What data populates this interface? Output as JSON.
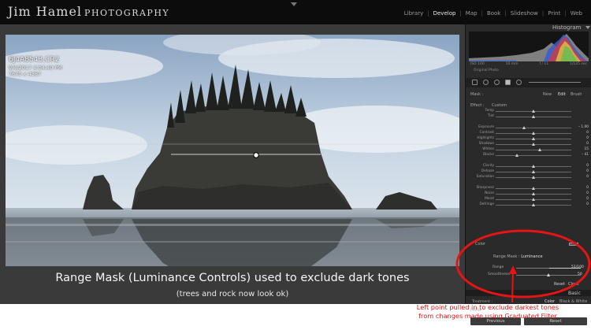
{
  "app": {
    "brand_main": "Jim Hamel",
    "brand_sub": "PHOTOGRAPHY"
  },
  "modules": [
    {
      "label": "Library",
      "active": false
    },
    {
      "label": "Develop",
      "active": true
    },
    {
      "label": "Map",
      "active": false
    },
    {
      "label": "Book",
      "active": false
    },
    {
      "label": "Slideshow",
      "active": false
    },
    {
      "label": "Print",
      "active": false
    },
    {
      "label": "Web",
      "active": false
    }
  ],
  "photo": {
    "filename": "6J4A8543.CR2",
    "date": "9/4/2017 4:04:40 PM",
    "dimensions": "7670 x 4367",
    "caption": "Range Mask (Luminance Controls) used to exclude dark tones",
    "caption_sub": "(trees and rock now look ok)"
  },
  "histogram": {
    "title": "Histogram",
    "iso": "ISO 100",
    "focal": "16 mm",
    "aperture": "f / 11",
    "shutter": "1/125 sec",
    "original_photo": "Original Photo"
  },
  "mask_panel": {
    "mask_label": "Mask :",
    "new_label": "New",
    "edit_label": "Edit",
    "brush_label": "Brush",
    "effect_label": "Effect :",
    "effect_value": "Custom",
    "sliders": [
      {
        "name": "Temp",
        "value": "",
        "pos": 0.5
      },
      {
        "name": "Tint",
        "value": "",
        "pos": 0.5
      },
      {
        "name": "Exposure",
        "value": "– 1.00",
        "pos": 0.38
      },
      {
        "name": "Contrast",
        "value": "0",
        "pos": 0.5
      },
      {
        "name": "Highlights",
        "value": "0",
        "pos": 0.5
      },
      {
        "name": "Shadows",
        "value": "0",
        "pos": 0.5
      },
      {
        "name": "Whites",
        "value": "15",
        "pos": 0.58
      },
      {
        "name": "Blacks",
        "value": "– 41",
        "pos": 0.28
      },
      {
        "name": "Clarity",
        "value": "0",
        "pos": 0.5
      },
      {
        "name": "Dehaze",
        "value": "0",
        "pos": 0.5
      },
      {
        "name": "Saturation",
        "value": "0",
        "pos": 0.5
      },
      {
        "name": "Sharpness",
        "value": "0",
        "pos": 0.5
      },
      {
        "name": "Noise",
        "value": "0",
        "pos": 0.5
      },
      {
        "name": "Moiré",
        "value": "0",
        "pos": 0.5
      },
      {
        "name": "Defringe",
        "value": "0",
        "pos": 0.5
      }
    ],
    "color_label": "Color",
    "range_title": "Range Mask :",
    "range_mode": "Luminance",
    "range_label": "Range",
    "range_value": "51/100",
    "range_low": 0.51,
    "range_high": 1.0,
    "smoothness_label": "Smoothness",
    "smoothness_value": "50",
    "smoothness": 0.5,
    "reset_label": "Reset",
    "close_label": "Close"
  },
  "basic_panel": {
    "title": "Basic",
    "treatment_label": "Treatment :",
    "treatment_color": "Color",
    "treatment_bw": "Black & White",
    "profile_label": "Profile :",
    "profile_value": "As Shot",
    "previous_label": "Previous",
    "reset_label": "Reset"
  },
  "annotation": {
    "line1": "Left point pulled in to exclude darkest tones",
    "line2": "from changes made using Graduated Filter",
    "color": "#e51515"
  }
}
